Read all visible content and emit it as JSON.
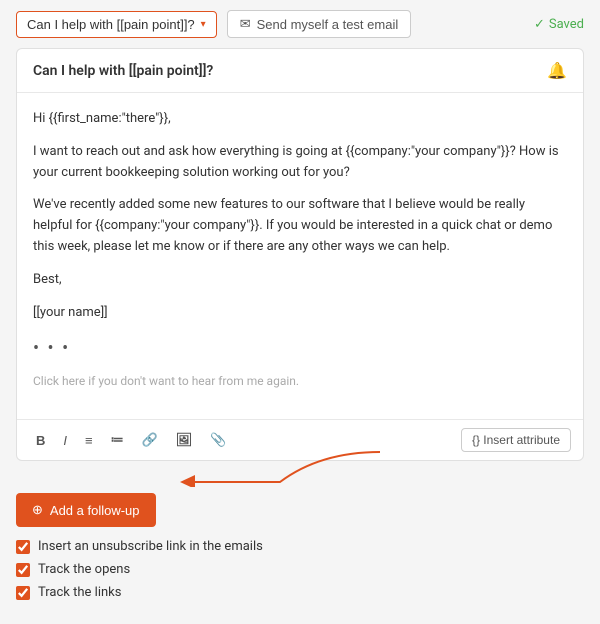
{
  "topbar": {
    "subject_label": "Can I help with [[pain point]]?",
    "test_email_label": "Send myself a test email",
    "saved_label": "Saved"
  },
  "email_card": {
    "header": "Can I help with [[pain point]]?",
    "body_lines": [
      "Hi {{first_name:\"there\"}},",
      "I want to reach out and ask how everything is going at {{company:\"your company\"}}? How is your current bookkeeping solution working out for you?",
      "We've recently added some new features to our software that I believe would be really helpful for {{company:\"your company\"}}. If you would be interested in a quick chat or demo this week, please let me know or if there are any other ways we can help.",
      "Best,",
      "[[your name]]"
    ],
    "unsubscribe_text": "if you don't want to hear from me again.",
    "unsubscribe_link": "Click here"
  },
  "toolbar": {
    "bold": "B",
    "italic": "I",
    "insert_attr_label": "{} Insert attribute"
  },
  "follow_up": {
    "button_label": "Add a follow-up"
  },
  "checkboxes": [
    {
      "label": "Insert an unsubscribe link in the emails",
      "checked": true
    },
    {
      "label": "Track the opens",
      "checked": true
    },
    {
      "label": "Track the links",
      "checked": true
    }
  ]
}
